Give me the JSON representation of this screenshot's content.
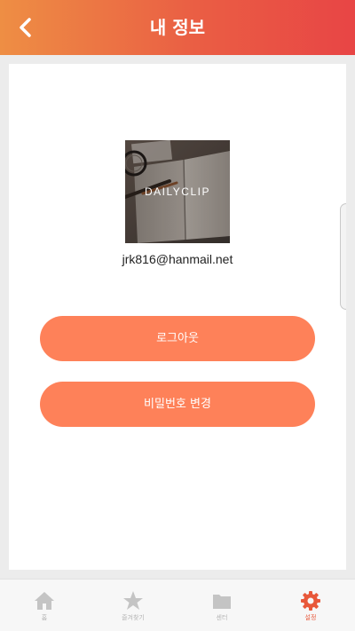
{
  "header": {
    "title": "내 정보",
    "back_icon": "chevron-left-icon"
  },
  "profile": {
    "image_label": "DAILYCLIP",
    "email": "jrk816@hanmail.net"
  },
  "actions": {
    "logout_label": "로그아웃",
    "change_password_label": "비밀번호 변경"
  },
  "nav": {
    "items": [
      {
        "label": "홈",
        "icon": "home-icon",
        "active": false
      },
      {
        "label": "즐겨찾기",
        "icon": "star-icon",
        "active": false
      },
      {
        "label": "센터",
        "icon": "folder-icon",
        "active": false
      },
      {
        "label": "설정",
        "icon": "gear-icon",
        "active": true
      }
    ]
  },
  "colors": {
    "header_start": "#ee8e44",
    "header_end": "#e84545",
    "button": "#fe8159",
    "nav_active": "#e8583a",
    "nav_inactive": "#c4c4c4"
  }
}
